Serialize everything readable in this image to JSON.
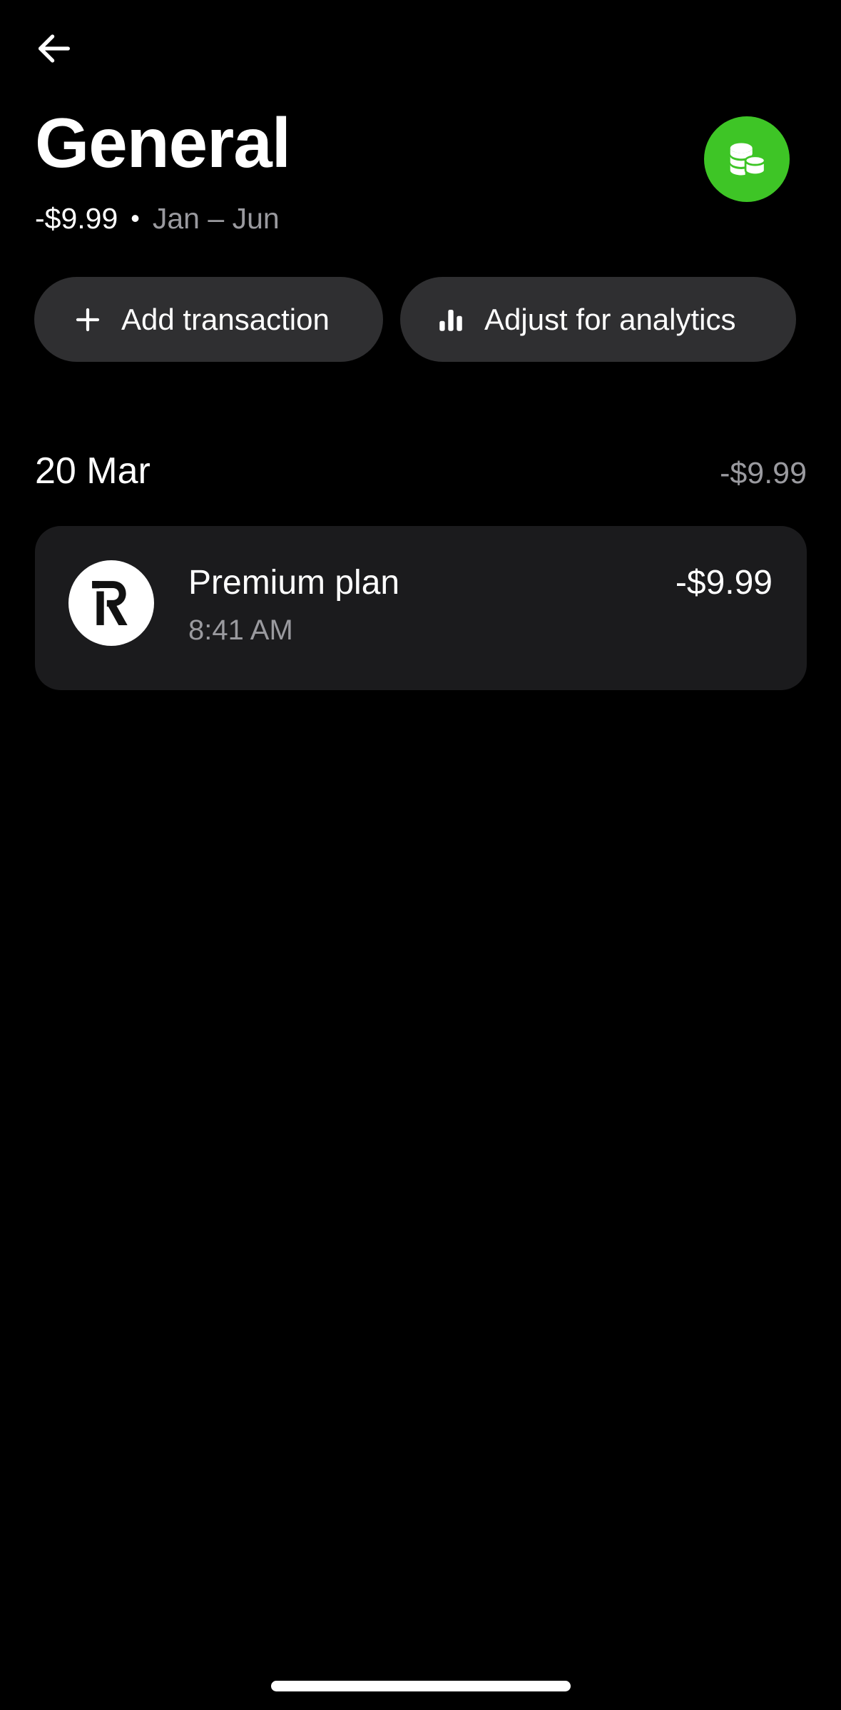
{
  "header": {
    "title": "General",
    "amount": "-$9.99",
    "separator": "•",
    "period": "Jan – Jun"
  },
  "actions": {
    "add_label": "Add transaction",
    "adjust_label": "Adjust for analytics"
  },
  "section": {
    "date": "20 Mar",
    "total": "-$9.99"
  },
  "transaction": {
    "name": "Premium plan",
    "time": "8:41 AM",
    "amount": "-$9.99",
    "logo_icon": "revolut-r-logo"
  },
  "icons": {
    "back": "arrow-left-icon",
    "category": "coins-icon",
    "add": "plus-icon",
    "analytics": "bar-chart-icon"
  },
  "colors": {
    "background": "#000000",
    "accent_green": "#3ec526",
    "pill_bg": "#2f2f31",
    "card_bg": "#1b1b1d",
    "muted_text": "#9a9a9f"
  }
}
